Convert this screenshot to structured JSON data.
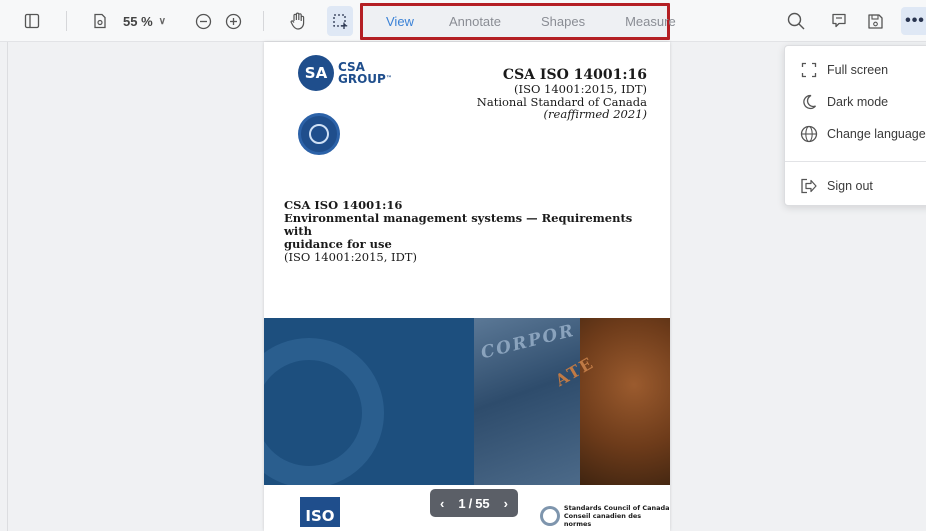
{
  "toolbar": {
    "zoom_value": "55 %",
    "zoom_chevron": "∨",
    "tabs": [
      {
        "label": "View",
        "active": true
      },
      {
        "label": "Annotate",
        "active": false
      },
      {
        "label": "Shapes",
        "active": false
      },
      {
        "label": "Measure",
        "active": false
      }
    ],
    "more_label": "•••",
    "icons": [
      "sidebar-toggle-icon",
      "page-settings-icon",
      "zoom-out-icon",
      "zoom-in-icon",
      "pan-hand-icon",
      "marquee-select-icon",
      "search-icon",
      "comment-icon",
      "save-icon",
      "more-icon"
    ]
  },
  "menu": {
    "items": [
      {
        "label": "Full screen",
        "icon": "fullscreen-icon"
      },
      {
        "label": "Dark mode",
        "icon": "moon-icon"
      },
      {
        "label": "Change language",
        "icon": "globe-icon"
      },
      {
        "label": "Sign out",
        "icon": "sign-out-icon"
      }
    ]
  },
  "document": {
    "logo_letters": "SA",
    "logo_line1": "CSA",
    "logo_line2": "GROUP",
    "logo_tm": "™",
    "std_title": "CSA ISO 14001:16",
    "std_sub1": "(ISO 14001:2015, IDT)",
    "std_sub2": "National Standard of Canada",
    "std_sub3": "(reaffirmed 2021)",
    "doc_line1": "CSA ISO 14001:16",
    "doc_line2": "Environmental management systems — Requirements with",
    "doc_line3": "guidance for use",
    "doc_line4": "(ISO 14001:2015, IDT)",
    "banner_text1": "CORPOR",
    "banner_text2": "ATE",
    "iso_logo": "ISO",
    "scc_line1": "Standards Council of Canada",
    "scc_line2": "Conseil canadien des normes"
  },
  "pager": {
    "prev": "‹",
    "current": "1",
    "separator": "/",
    "total": "55",
    "next": "›"
  },
  "colors": {
    "accent": "#3b82d6",
    "highlight_border": "#b41f24",
    "csa_blue": "#1f4e8c",
    "pager_bg": "#5b5f67"
  }
}
